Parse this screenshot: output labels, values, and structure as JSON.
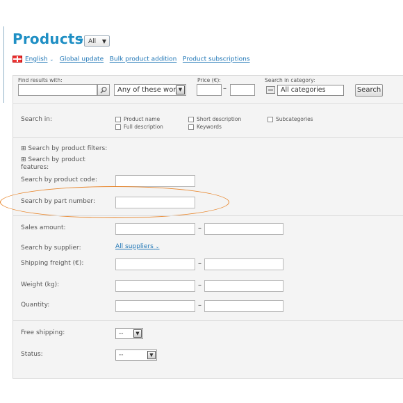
{
  "header": {
    "title": "Products",
    "title_sep": "-",
    "filter_dropdown": "All"
  },
  "links": [
    {
      "label": "English"
    },
    {
      "label": "Global update"
    },
    {
      "label": "Bulk product addition"
    },
    {
      "label": "Product subscriptions"
    }
  ],
  "search": {
    "find_label": "Find results with:",
    "match_mode": "Any of these words",
    "price_label": "Price (€):",
    "category_label": "Search in category:",
    "category_value": "All categories",
    "search_button": "Search"
  },
  "search_in": {
    "label": "Search in:",
    "options": [
      "Product name",
      "Full description",
      "Short description",
      "Keywords",
      "Subcategories"
    ]
  },
  "filters": {
    "by_filters": "Search by product filters:",
    "by_features": "Search by product features:",
    "by_code": "Search by product code:",
    "by_part": "Search by part number:",
    "sales_amount": "Sales amount:",
    "by_supplier": "Search by supplier:",
    "supplier_link": "All suppliers",
    "shipping": "Shipping freight (€):",
    "weight": "Weight (kg):",
    "quantity": "Quantity:",
    "free_shipping": "Free shipping:",
    "free_shipping_value": "--",
    "status": "Status:",
    "status_value": "--"
  },
  "colors": {
    "title": "#1f8fc4",
    "link": "#1c74b5",
    "highlight_oval": "#e8852a"
  }
}
